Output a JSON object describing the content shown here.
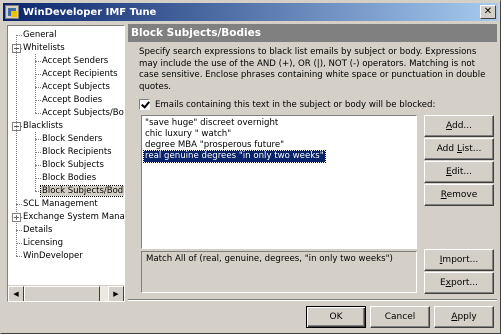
{
  "window": {
    "title": "WinDeveloper IMF Tune"
  },
  "tree": {
    "items": [
      {
        "label": "General",
        "level": 0,
        "expander": ""
      },
      {
        "label": "Whitelists",
        "level": 0,
        "expander": "−"
      },
      {
        "label": "Accept Senders",
        "level": 1,
        "expander": ""
      },
      {
        "label": "Accept Recipients",
        "level": 1,
        "expander": ""
      },
      {
        "label": "Accept Subjects",
        "level": 1,
        "expander": ""
      },
      {
        "label": "Accept Bodies",
        "level": 1,
        "expander": ""
      },
      {
        "label": "Accept Subjects/Bodie",
        "level": 1,
        "expander": ""
      },
      {
        "label": "Blacklists",
        "level": 0,
        "expander": "−"
      },
      {
        "label": "Block Senders",
        "level": 1,
        "expander": ""
      },
      {
        "label": "Block Recipients",
        "level": 1,
        "expander": ""
      },
      {
        "label": "Block Subjects",
        "level": 1,
        "expander": ""
      },
      {
        "label": "Block Bodies",
        "level": 1,
        "expander": ""
      },
      {
        "label": "Block Subjects/Bodies",
        "level": 1,
        "expander": "",
        "selected": true
      },
      {
        "label": "SCL Management",
        "level": 0,
        "expander": ""
      },
      {
        "label": "Exchange System Manag",
        "level": 0,
        "expander": "+"
      },
      {
        "label": "Details",
        "level": 0,
        "expander": ""
      },
      {
        "label": "Licensing",
        "level": 0,
        "expander": ""
      },
      {
        "label": "WinDeveloper",
        "level": 0,
        "expander": ""
      }
    ]
  },
  "panel": {
    "title": "Block Subjects/Bodies",
    "description": "Specify search expressions to black list emails by subject or body. Expressions may include the use of the AND (+), OR (|), NOT (-) operators. Matching is not case sensitive. Enclose phrases containing white space or punctuation in double quotes.",
    "checkbox_label": "Emails containing this text in the subject or body will be blocked:",
    "checkbox_checked": true,
    "expressions": [
      "\"save huge\" discreet overnight",
      "chic luxury \" watch\"",
      "degree MBA \"prosperous future\"",
      "real genuine degrees \"in only two weeks\""
    ],
    "selected_index": 3,
    "match_text": "Match All of (real, genuine, degrees, \"in only two weeks\")"
  },
  "buttons": {
    "add": {
      "pre": "",
      "u": "A",
      "post": "dd..."
    },
    "add_list": {
      "pre": "Add ",
      "u": "L",
      "post": "ist..."
    },
    "edit": {
      "pre": "",
      "u": "E",
      "post": "dit..."
    },
    "remove": {
      "pre": "",
      "u": "R",
      "post": "emove"
    },
    "import": {
      "pre": "",
      "u": "I",
      "post": "mport..."
    },
    "export": {
      "pre": "E",
      "u": "x",
      "post": "port..."
    },
    "ok": "OK",
    "cancel": "Cancel",
    "apply": {
      "pre": "",
      "u": "A",
      "post": "pply"
    }
  }
}
